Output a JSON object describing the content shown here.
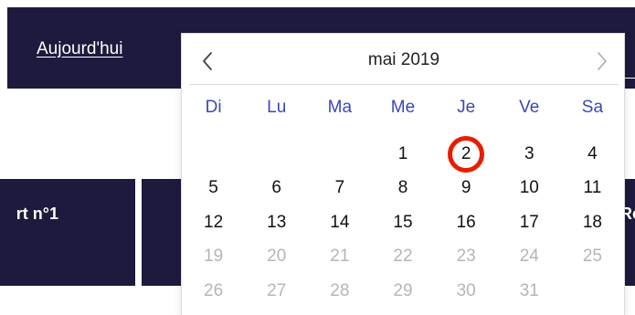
{
  "topbar": {
    "today_label": "Aujourd'hui"
  },
  "cards": {
    "left_label": "rt n°1",
    "right_label": "Re"
  },
  "calendar": {
    "month_label": "mai 2019",
    "prev_icon": "chevron-left-icon",
    "next_icon": "chevron-right-icon",
    "weekdays": [
      "Di",
      "Lu",
      "Ma",
      "Me",
      "Je",
      "Ve",
      "Sa"
    ],
    "weeks": [
      [
        "",
        "",
        "",
        "1",
        "2",
        "3",
        "4"
      ],
      [
        "5",
        "6",
        "7",
        "8",
        "9",
        "10",
        "11"
      ],
      [
        "12",
        "13",
        "14",
        "15",
        "16",
        "17",
        "18"
      ],
      [
        "19",
        "20",
        "21",
        "22",
        "23",
        "24",
        "25"
      ],
      [
        "26",
        "27",
        "28",
        "29",
        "30",
        "31",
        ""
      ]
    ],
    "highlighted_day": "2",
    "colors": {
      "weekday": "#3a48b8",
      "highlight_ring": "#e81d00",
      "disabled_day": "#b5b5b5",
      "navy": "#1d1a3d"
    }
  }
}
